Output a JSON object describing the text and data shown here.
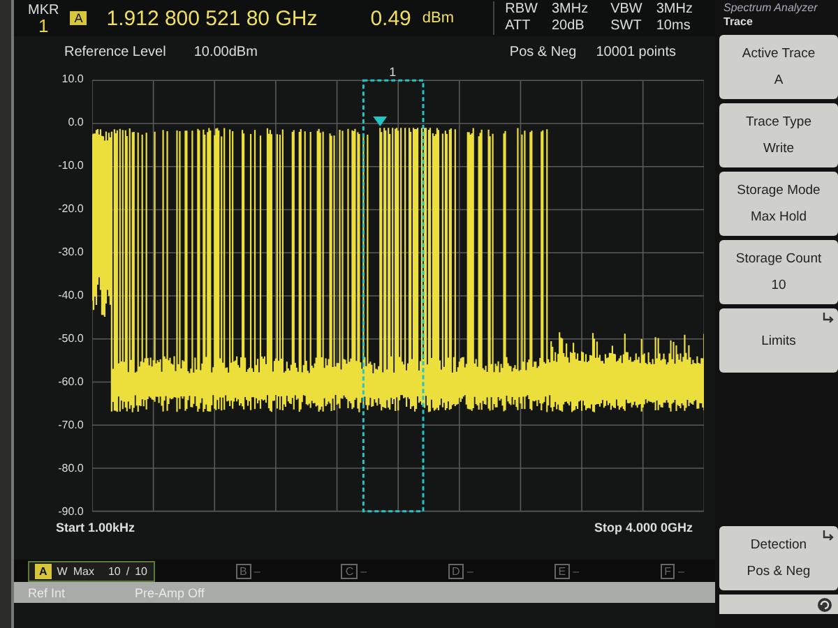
{
  "marker": {
    "label": "MKR",
    "number": "1",
    "trace": "A",
    "frequency": "1.912 800 521 80 GHz",
    "level": "0.49",
    "unit": "dBm"
  },
  "settings": [
    {
      "label": "RBW",
      "value": "3MHz"
    },
    {
      "label": "VBW",
      "value": "3MHz"
    },
    {
      "label": "ATT",
      "value": "20dB"
    },
    {
      "label": "SWT",
      "value": "10ms"
    }
  ],
  "plot": {
    "reference_label": "Reference Level",
    "reference_value": "10.00dBm",
    "detector": "Pos & Neg",
    "points": "10001 points",
    "marker_number": "1",
    "y_axis_labels": [
      "10.0",
      "0.0",
      "-10.0",
      "-20.0",
      "-30.0",
      "-40.0",
      "-50.0",
      "-60.0",
      "-70.0",
      "-80.0",
      "-90.0"
    ],
    "start": "Start 1.00kHz",
    "stop": "Stop 4.000 0GHz"
  },
  "traces": [
    {
      "letter": "A",
      "mode": "W",
      "detail": "Max",
      "count": "10",
      "separator": "/",
      "total": "10",
      "active": true
    },
    {
      "letter": "B",
      "detail": "–",
      "active": false
    },
    {
      "letter": "C",
      "detail": "–",
      "active": false
    },
    {
      "letter": "D",
      "detail": "–",
      "active": false
    },
    {
      "letter": "E",
      "detail": "–",
      "active": false
    },
    {
      "letter": "F",
      "detail": "–",
      "active": false
    }
  ],
  "status": [
    "Ref Int",
    "Pre-Amp Off"
  ],
  "panel": {
    "app": "Spectrum Analyzer",
    "menu": "Trace",
    "softkeys": [
      {
        "label": "Active Trace",
        "value": "A",
        "submenu": false
      },
      {
        "label": "Trace Type",
        "value": "Write",
        "submenu": false
      },
      {
        "label": "Storage Mode",
        "value": "Max Hold",
        "submenu": false
      },
      {
        "label": "Storage Count",
        "value": "10",
        "submenu": false
      },
      {
        "label": "Limits",
        "submenu": true
      }
    ],
    "bottom_softkeys": [
      {
        "label": "Detection",
        "value": "Pos & Neg",
        "submenu": true
      }
    ]
  }
}
